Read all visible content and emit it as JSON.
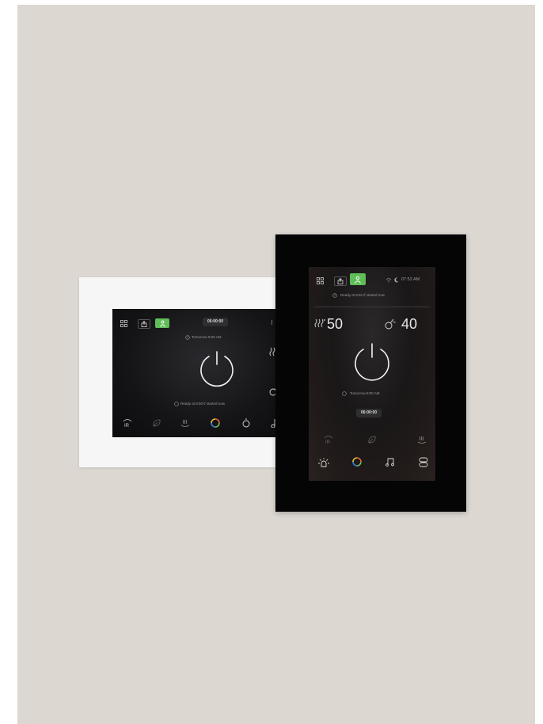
{
  "landscape_panel": {
    "status_time": "06:00:00",
    "tomorrow_text": "Tomorrow 8:00 AM",
    "ready_text": "Ready at 8:50 if started now",
    "icons": [
      "grid-icon",
      "export-icon",
      "person-icon",
      "infrared-icon",
      "leaf-icon",
      "steam-icon",
      "color-light-icon",
      "aroma-icon",
      "music-icon"
    ],
    "ir_label": "IR"
  },
  "portrait_panel": {
    "clock": "07:52 AM",
    "ready_text": "Ready at 8:50 if started now",
    "temperature": "50",
    "humidity": "40",
    "tomorrow_text": "Tomorrow 8:00 AM",
    "timer": "06:00:00",
    "ir_label": "IR",
    "icons": [
      "grid-icon",
      "export-icon",
      "person-icon",
      "wifi-icon",
      "moon-icon",
      "heat-icon",
      "humidity-icon",
      "power-icon",
      "infrared-icon",
      "leaf-icon",
      "steam-icon",
      "light-icon",
      "color-light-icon",
      "music-icon",
      "fan-icon"
    ]
  },
  "colors": {
    "accent_green": "#5fbe58",
    "beige_background": "#dcd7d1"
  }
}
